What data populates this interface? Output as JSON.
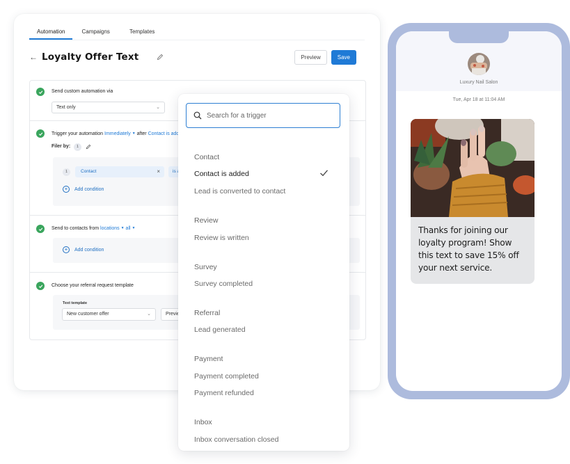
{
  "app": {
    "tabs": [
      {
        "label": "Automation",
        "active": true
      },
      {
        "label": "Campaigns",
        "active": false
      },
      {
        "label": "Templates",
        "active": false
      }
    ],
    "title": "Loyalty Offer Text",
    "back_icon": "arrow-left-icon",
    "edit_icon": "pencil-icon",
    "preview_label": "Preview",
    "save_label": "Save",
    "accent_color": "#1f7ad6",
    "success_color": "#3aa55d",
    "steps": {
      "send_via": {
        "label": "Send custom automation via",
        "select_value": "Text only"
      },
      "trigger": {
        "label_prefix": "Trigger your automation",
        "timing": "Immediately",
        "after": "after",
        "event": "Contact is added",
        "filter_label": "Filer by:",
        "filter_count": "1",
        "condition_index": "1",
        "condition_field": "Contact",
        "condition_operator": "is added",
        "add_condition": "Add condition"
      },
      "send_to": {
        "label_prefix": "Send to contacts from",
        "scope": "locations",
        "scope_value": "all",
        "add_condition": "Add condition"
      },
      "template": {
        "label": "Choose your referral request template",
        "field_label": "Text template",
        "select_value": "New customer offer",
        "preview_label": "Preview"
      }
    }
  },
  "trigger_dropdown": {
    "search_placeholder": "Search for a trigger",
    "search_value": "",
    "groups": [
      {
        "name": "Contact",
        "items": [
          {
            "label": "Contact is added",
            "selected": true
          },
          {
            "label": "Lead is converted to contact",
            "selected": false
          }
        ]
      },
      {
        "name": "Review",
        "items": [
          {
            "label": "Review is written",
            "selected": false
          }
        ]
      },
      {
        "name": "Survey",
        "items": [
          {
            "label": "Survey completed",
            "selected": false
          }
        ]
      },
      {
        "name": "Referral",
        "items": [
          {
            "label": "Lead generated",
            "selected": false
          }
        ]
      },
      {
        "name": "Payment",
        "items": [
          {
            "label": "Payment completed",
            "selected": false
          },
          {
            "label": "Payment refunded",
            "selected": false
          }
        ]
      },
      {
        "name": "Inbox",
        "items": [
          {
            "label": "Inbox conversation closed",
            "selected": false
          }
        ]
      }
    ]
  },
  "phone_preview": {
    "frame_color": "#adbbdd",
    "sender_name": "Luxury Nail Salon",
    "timestamp": "Tue, Apr 18 at 11:04 AM",
    "message_text": "Thanks for joining our loyalty program! Show this text to save 15% off your next service.",
    "image_description": "manicured hand with knit sweater sleeve and potted succulents"
  }
}
